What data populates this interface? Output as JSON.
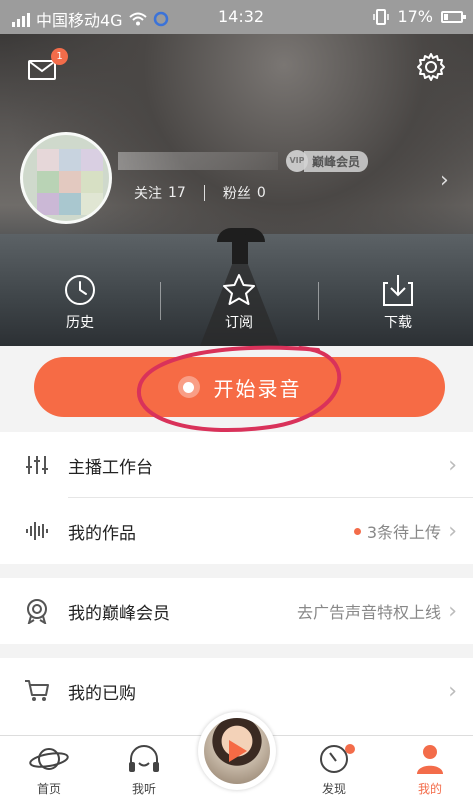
{
  "status_bar": {
    "carrier": "中国移动4G",
    "time": "14:32",
    "battery": "17%"
  },
  "header": {
    "mail_badge": "1",
    "vip_icon_text": "VIP",
    "vip_label": "巅峰会员",
    "follow_label": "关注",
    "follow_count": "17",
    "fans_label": "粉丝",
    "fans_count": "0"
  },
  "shortcuts": [
    {
      "label": "历史",
      "icon": "clock-icon"
    },
    {
      "label": "订阅",
      "icon": "star-icon"
    },
    {
      "label": "下载",
      "icon": "download-icon"
    }
  ],
  "record": {
    "label": "开始录音"
  },
  "menu": {
    "group1": [
      {
        "title": "主播工作台",
        "icon": "sliders-icon",
        "right": ""
      },
      {
        "title": "我的作品",
        "icon": "waveform-icon",
        "right": "3条待上传"
      }
    ],
    "group2": [
      {
        "title": "我的巅峰会员",
        "icon": "medal-icon",
        "right": "去广告声音特权上线"
      }
    ],
    "group3": [
      {
        "title": "我的已购",
        "icon": "cart-icon",
        "right": ""
      }
    ]
  },
  "tabbar": [
    {
      "label": "首页",
      "icon": "planet-icon",
      "active": false
    },
    {
      "label": "我听",
      "icon": "headphones-icon",
      "active": false
    },
    {
      "label": "发现",
      "icon": "compass-icon",
      "active": false
    },
    {
      "label": "我的",
      "icon": "person-icon",
      "active": true
    }
  ],
  "colors": {
    "accent": "#f66b45",
    "annotation": "#d9325a"
  }
}
